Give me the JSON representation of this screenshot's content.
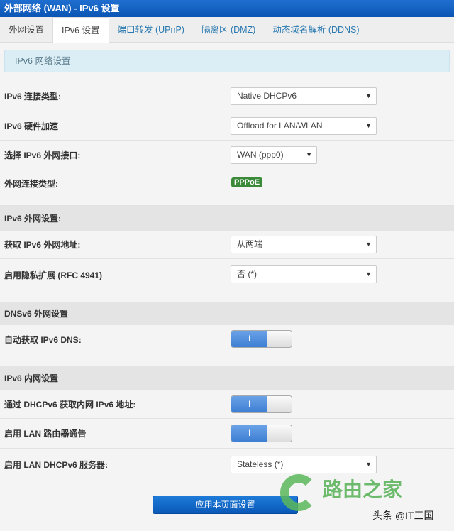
{
  "title": "外部网络 (WAN) - IPv6 设置",
  "tabs": [
    "外网设置",
    "IPv6 设置",
    "端口转发 (UPnP)",
    "隔离区 (DMZ)",
    "动态域名解析 (DDNS)"
  ],
  "active_tab": "IPv6 设置",
  "info": "IPv6 网络设置",
  "rows": {
    "conn_type": {
      "label": "IPv6 连接类型:",
      "value": "Native DHCPv6"
    },
    "hw_accel": {
      "label": "IPv6 硬件加速",
      "value": "Offload for LAN/WLAN"
    },
    "wan_if": {
      "label": "选择 IPv6 外网接口:",
      "value": "WAN (ppp0)"
    },
    "wan_type": {
      "label": "外网连接类型:",
      "value": "PPPoE"
    },
    "get_addr": {
      "label": "获取 IPv6 外网地址:",
      "value": "从两端"
    },
    "privacy": {
      "label": "启用隐私扩展 (RFC 4941)",
      "value": "否 (*)"
    },
    "auto_dns": {
      "label": "自动获取 IPv6 DNS:",
      "toggle": "I",
      "on": true
    },
    "dhcp_lan": {
      "label": "通过 DHCPv6 获取内网 IPv6 地址:",
      "toggle": "I",
      "on": true
    },
    "ra": {
      "label": "启用 LAN 路由器通告",
      "toggle": "I",
      "on": true
    },
    "dhcp_server": {
      "label": "启用 LAN DHCPv6 服务器:",
      "value": "Stateless (*)"
    }
  },
  "sections": {
    "wan": "IPv6 外网设置:",
    "dns": "DNSv6 外网设置",
    "lan": "IPv6 内网设置"
  },
  "apply": "应用本页面设置",
  "watermark": {
    "logo": "路由之家",
    "credit": "头条 @IT三国"
  },
  "colors": {
    "titlebar": "#0b55b4",
    "badge": "#3a8a3a",
    "toggle_on": "#3d7fd4"
  }
}
